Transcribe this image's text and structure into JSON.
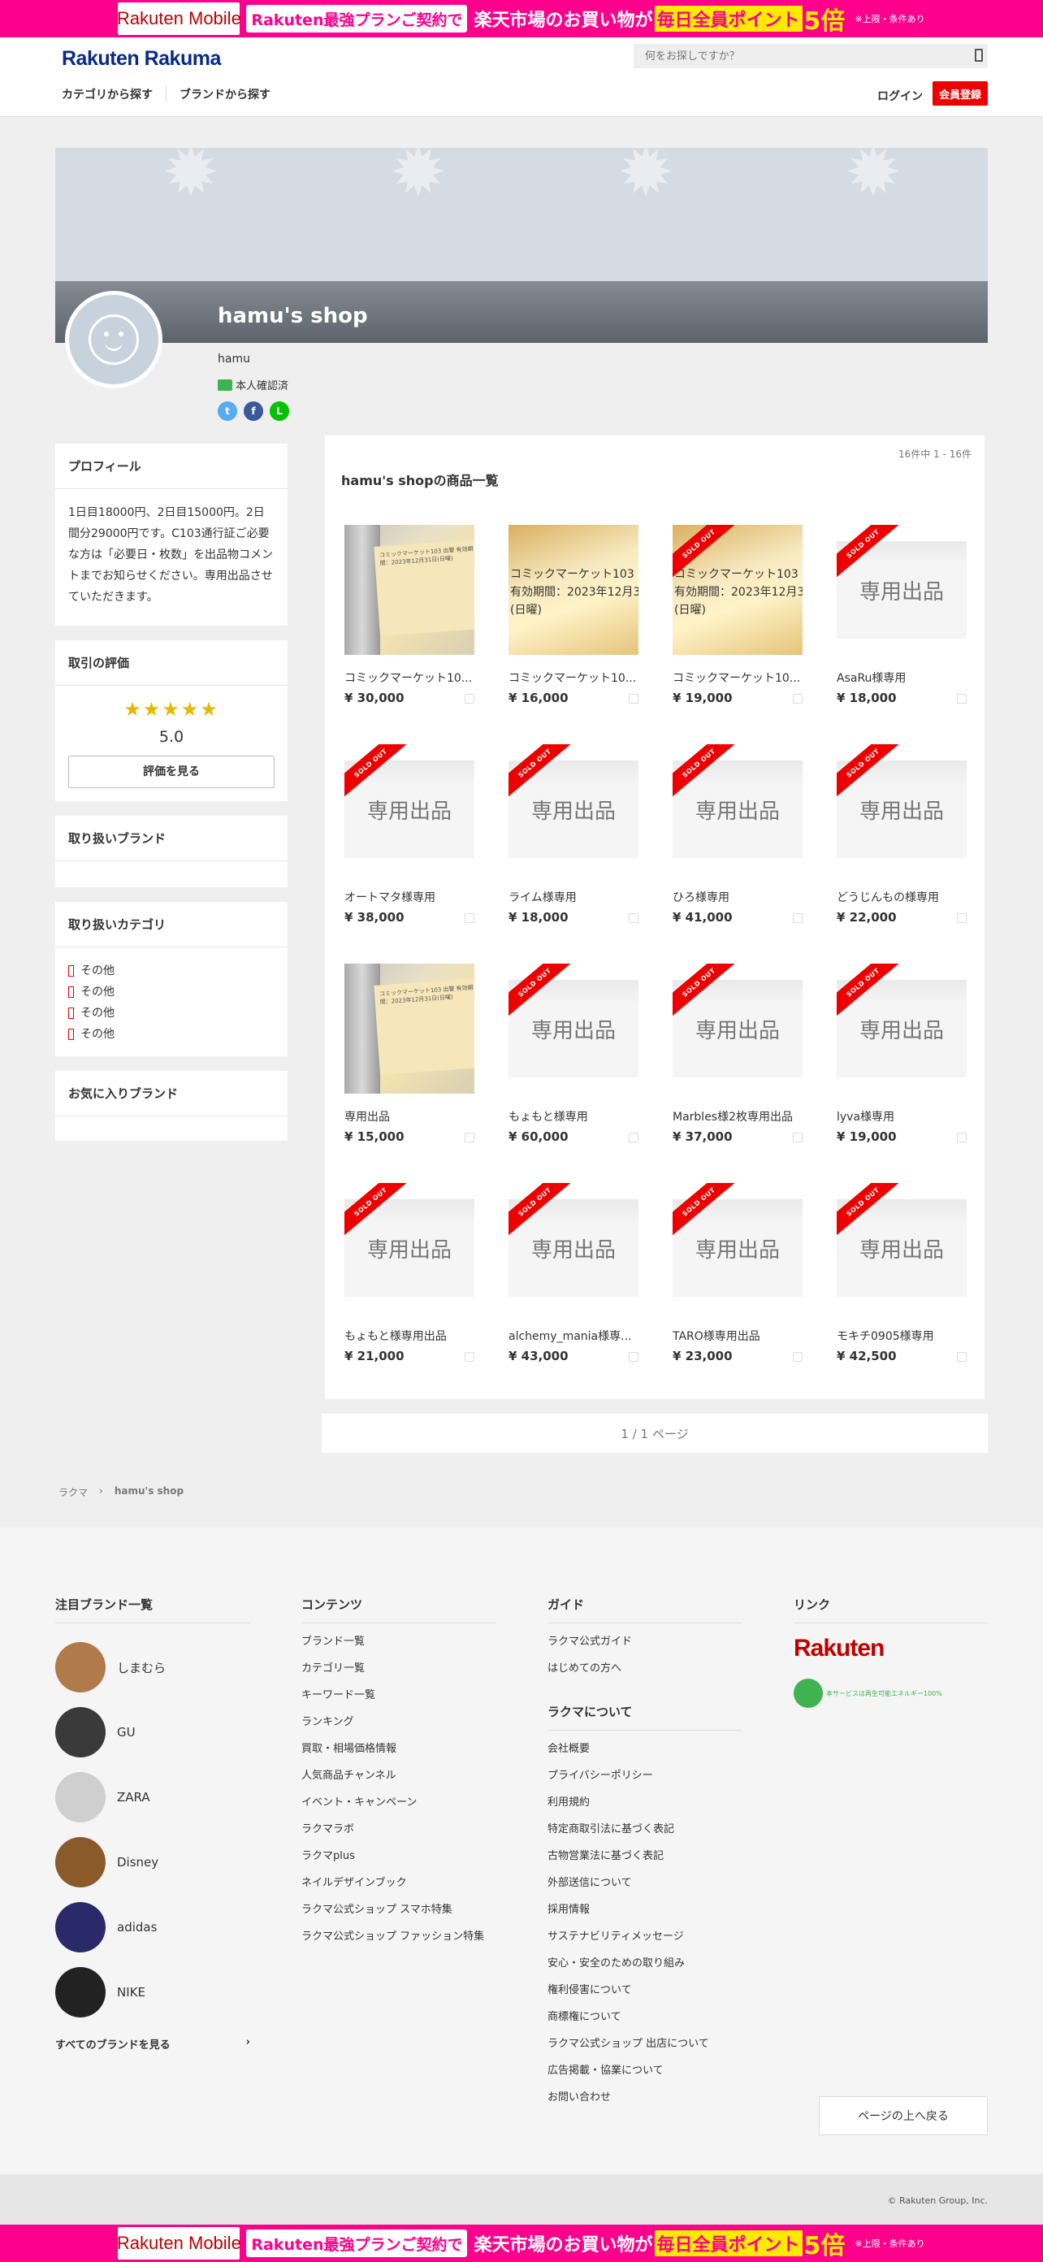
{
  "promo": {
    "logo": "Rakuten",
    "logo_sub": "Mobile",
    "pill": "Rakuten最強プランご契約で",
    "text_pre": "楽天市場",
    "text_mid": "のお買い物が",
    "highlight": "毎日全員ポイント",
    "big": "5倍",
    "note": "※上限・条件あり"
  },
  "header": {
    "logo": "Rakuten Rakuma",
    "search_placeholder": "何をお探しですか？",
    "nav": [
      "カテゴリから探す",
      "ブランドから探す"
    ],
    "login": "ログイン",
    "register": "会員登録"
  },
  "shop": {
    "name": "hamu's shop",
    "user": "hamu",
    "verified": "本人確認済"
  },
  "sidebar": {
    "profile_title": "プロフィール",
    "profile_text": "1日目18000円、2日目15000円。2日間分29000円です。C103通行証ご必要な方は「必要日・枚数」を出品物コメントまでお知らせください。専用出品させていただきます。",
    "review_title": "取引の評価",
    "stars": "★★★★★",
    "rating": "5.0",
    "review_button": "評価を見る",
    "brands_title": "取り扱いブランド",
    "categories_title": "取り扱いカテゴリ",
    "categories": [
      "その他",
      "その他",
      "その他",
      "その他"
    ],
    "fav_title": "お気に入りブランド"
  },
  "products": {
    "count": "16件中 1 - 16件",
    "title": "hamu's shopの商品一覧",
    "sold_label": "SOLD OUT",
    "placeholder_label": "専用出品",
    "photo_text": "コミックマーケット103 出警 有効期間：2023年12月31日(日曜)",
    "items": [
      {
        "name": "コミックマーケット10...",
        "price": "¥ 30,000",
        "thumb": "photo",
        "sold": false
      },
      {
        "name": "コミックマーケット10...",
        "price": "¥ 16,000",
        "thumb": "photo2",
        "sold": false
      },
      {
        "name": "コミックマーケット10...",
        "price": "¥ 19,000",
        "thumb": "photo2",
        "sold": true
      },
      {
        "name": "AsaRu様専用",
        "price": "¥ 18,000",
        "thumb": "solo",
        "sold": true
      },
      {
        "name": "オートマタ様専用",
        "price": "¥ 38,000",
        "thumb": "solo",
        "sold": true
      },
      {
        "name": "ライム様専用",
        "price": "¥ 18,000",
        "thumb": "solo",
        "sold": true
      },
      {
        "name": "ひろ様専用",
        "price": "¥ 41,000",
        "thumb": "solo",
        "sold": true
      },
      {
        "name": "どうじんもの様専用",
        "price": "¥ 22,000",
        "thumb": "solo",
        "sold": true
      },
      {
        "name": "専用出品",
        "price": "¥ 15,000",
        "thumb": "photo",
        "sold": false
      },
      {
        "name": "もょもと様専用",
        "price": "¥ 60,000",
        "thumb": "solo",
        "sold": true
      },
      {
        "name": "Marbles様2枚専用出品",
        "price": "¥ 37,000",
        "thumb": "solo",
        "sold": true
      },
      {
        "name": "lyva様専用",
        "price": "¥ 19,000",
        "thumb": "solo",
        "sold": true
      },
      {
        "name": "もょもと様専用出品",
        "price": "¥ 21,000",
        "thumb": "solo",
        "sold": true
      },
      {
        "name": "alchemy_mania様専...",
        "price": "¥ 43,000",
        "thumb": "solo",
        "sold": true
      },
      {
        "name": "TARO様専用出品",
        "price": "¥ 23,000",
        "thumb": "solo",
        "sold": true
      },
      {
        "name": "モキチ0905様専用",
        "price": "¥ 42,500",
        "thumb": "solo",
        "sold": true
      }
    ]
  },
  "pager": "1 / 1 ページ",
  "breadcrumb": [
    "ラクマ",
    "hamu's shop"
  ],
  "footer": {
    "brands_title": "注目ブランド一覧",
    "brands": [
      {
        "name": "しまむら",
        "color": "#b07a4a"
      },
      {
        "name": "GU",
        "color": "#3a3a3a"
      },
      {
        "name": "ZARA",
        "color": "#cfcfcf"
      },
      {
        "name": "Disney",
        "color": "#8a5a2b"
      },
      {
        "name": "adidas",
        "color": "#2a2a6a"
      },
      {
        "name": "NIKE",
        "color": "#222222"
      }
    ],
    "all_brands": "すべてのブランドを見る",
    "contents_title": "コンテンツ",
    "contents": [
      "ブランド一覧",
      "カテゴリ一覧",
      "キーワード一覧",
      "ランキング",
      "買取・相場価格情報",
      "人気商品チャンネル",
      "イベント・キャンペーン",
      "ラクマラボ",
      "ラクマplus",
      "ネイルデザインブック",
      "ラクマ公式ショップ スマホ特集",
      "ラクマ公式ショップ ファッション特集"
    ],
    "guide_title": "ガイド",
    "guide": [
      "ラクマ公式ガイド",
      "はじめての方へ"
    ],
    "about_title": "ラクマについて",
    "about": [
      "会社概要",
      "プライバシーポリシー",
      "利用規約",
      "特定商取引法に基づく表記",
      "古物営業法に基づく表記",
      "外部送信について",
      "採用情報",
      "サステナビリティメッセージ",
      "安心・安全のための取り組み",
      "権利侵害について",
      "商標権について",
      "ラクマ公式ショップ 出店について",
      "広告掲載・協業について",
      "お問い合わせ"
    ],
    "links_title": "リンク",
    "rakuten": "Rakuten",
    "green_text": "本サービスは再生可能エネルギー100%",
    "to_top": "ページの上へ戻る",
    "copyright": "© Rakuten Group, Inc."
  },
  "colors": {
    "accent": "#ee0000",
    "promo": "#ff008c",
    "brand_navy": "#0a2a8a"
  }
}
